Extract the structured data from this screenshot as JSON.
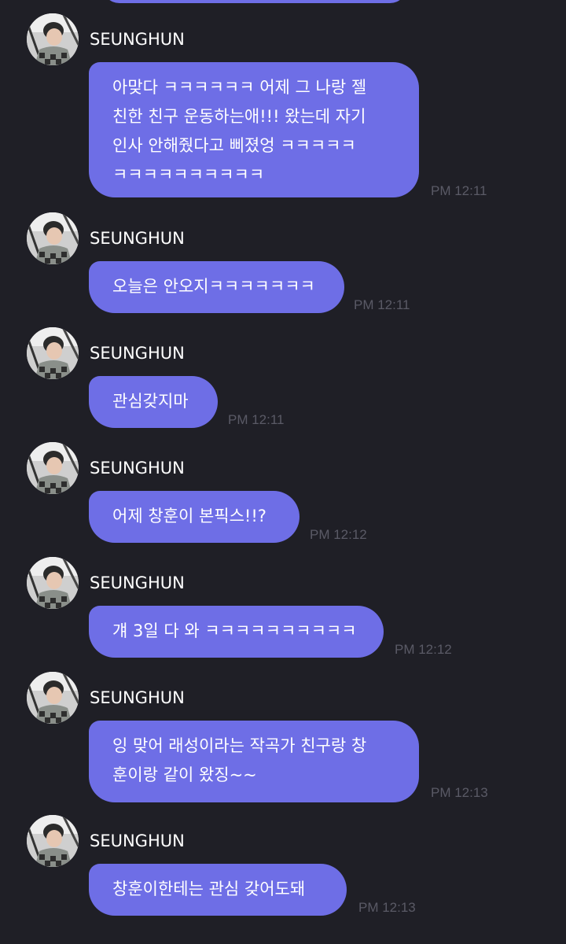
{
  "messages": [
    {
      "sender": "SEUNGHUN",
      "text": "아맞다 ㅋㅋㅋㅋㅋㅋ 어제 그 나랑 젤\n친한 친구 운동하는애!!! 왔는데 자기\n인사 안해줬다고 삐졌엉 ㅋㅋㅋㅋㅋ\nㅋㅋㅋㅋㅋㅋㅋㅋㅋㅋ",
      "time": "PM 12:11"
    },
    {
      "sender": "SEUNGHUN",
      "text": "오늘은 안오지ㅋㅋㅋㅋㅋㅋㅋ",
      "time": "PM 12:11"
    },
    {
      "sender": "SEUNGHUN",
      "text": "관심갖지마",
      "time": "PM 12:11"
    },
    {
      "sender": "SEUNGHUN",
      "text": "어제 창훈이 본픽스!!?",
      "time": "PM 12:12"
    },
    {
      "sender": "SEUNGHUN",
      "text": "걔 3일 다 와 ㅋㅋㅋㅋㅋㅋㅋㅋㅋㅋ",
      "time": "PM 12:12"
    },
    {
      "sender": "SEUNGHUN",
      "text": "잉 맞어 래성이라는 작곡가 친구랑 창\n훈이랑 같이 왔징~~",
      "time": "PM 12:13"
    },
    {
      "sender": "SEUNGHUN",
      "text": "창훈이한테는 관심 갖어도돼",
      "time": "PM 12:13"
    }
  ],
  "colors": {
    "background": "#1f1f26",
    "bubble": "#6e6ee6",
    "sender_text": "#ffffff",
    "timestamp": "#5a5a66"
  }
}
